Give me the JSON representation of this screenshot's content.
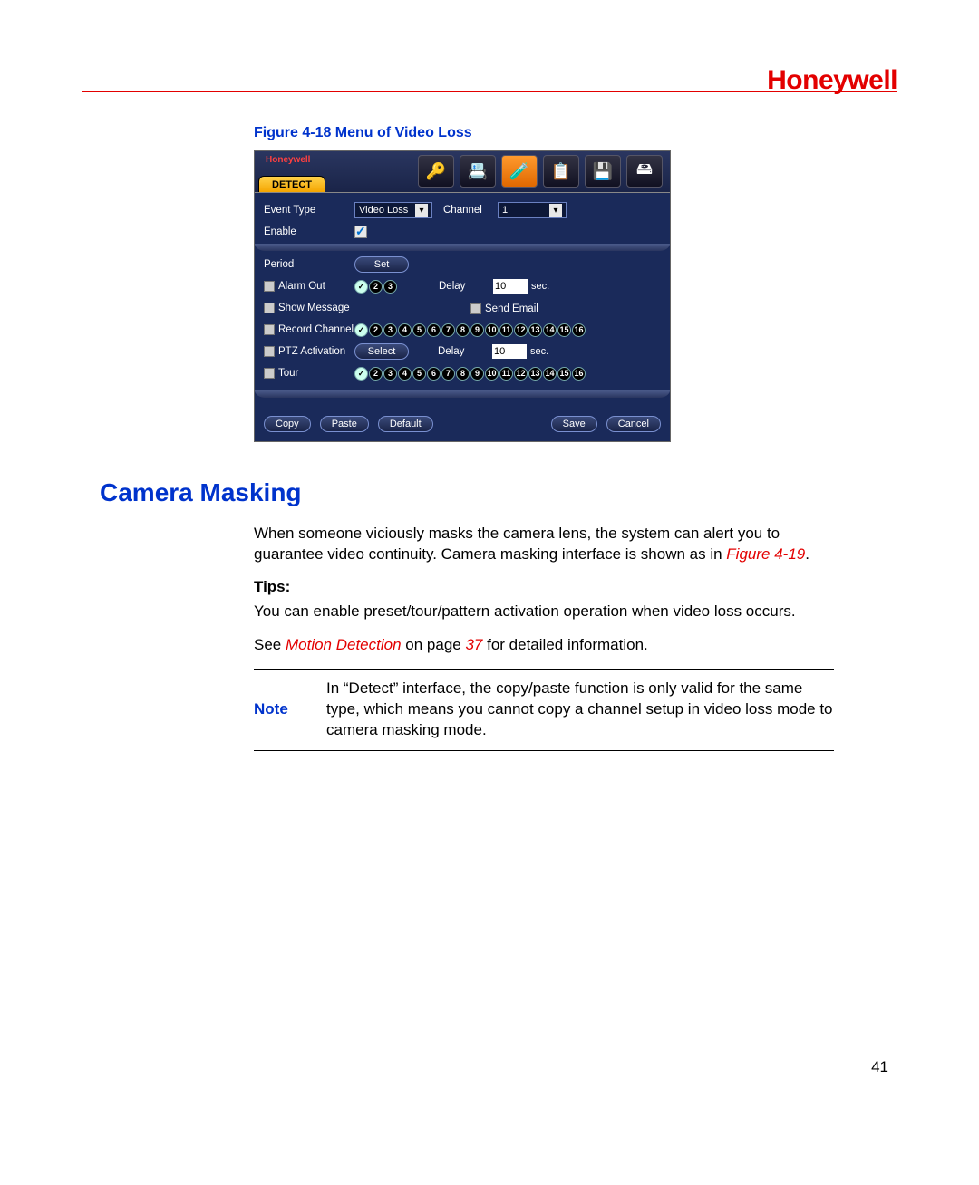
{
  "brand": "Honeywell",
  "figure_caption": "Figure 4-18 Menu of Video Loss",
  "dvr": {
    "logo": "Honeywell",
    "tab": "DETECT",
    "top_icons": [
      "keys-icon",
      "card-icon",
      "bottles-icon",
      "clipboard-icon",
      "disk-icon",
      "drive-icon"
    ],
    "highlight_icon_index": 2,
    "event_type_label": "Event Type",
    "event_type_value": "Video Loss",
    "channel_label": "Channel",
    "channel_value": "1",
    "enable_label": "Enable",
    "enable_checked": true,
    "period_label": "Period",
    "period_button": "Set",
    "alarm_out_label": "Alarm Out",
    "alarm_out_channels": [
      {
        "n": "1",
        "on": true
      },
      {
        "n": "2",
        "on": false
      },
      {
        "n": "3",
        "on": false
      }
    ],
    "delay_label": "Delay",
    "delay1_value": "10",
    "sec_label": "sec.",
    "show_message_label": "Show Message",
    "send_email_label": "Send Email",
    "record_channel_label": "Record Channel",
    "record_channels": [
      {
        "n": "1",
        "on": true
      },
      {
        "n": "2",
        "on": false
      },
      {
        "n": "3",
        "on": false
      },
      {
        "n": "4",
        "on": false
      },
      {
        "n": "5",
        "on": false
      },
      {
        "n": "6",
        "on": false
      },
      {
        "n": "7",
        "on": false
      },
      {
        "n": "8",
        "on": false
      },
      {
        "n": "9",
        "on": false
      },
      {
        "n": "10",
        "on": false
      },
      {
        "n": "11",
        "on": false
      },
      {
        "n": "12",
        "on": false
      },
      {
        "n": "13",
        "on": false
      },
      {
        "n": "14",
        "on": false
      },
      {
        "n": "15",
        "on": false
      },
      {
        "n": "16",
        "on": false
      }
    ],
    "ptz_label": "PTZ Activation",
    "ptz_button": "Select",
    "delay2_value": "10",
    "tour_label": "Tour",
    "tour_channels": [
      {
        "n": "1",
        "on": true
      },
      {
        "n": "2",
        "on": false
      },
      {
        "n": "3",
        "on": false
      },
      {
        "n": "4",
        "on": false
      },
      {
        "n": "5",
        "on": false
      },
      {
        "n": "6",
        "on": false
      },
      {
        "n": "7",
        "on": false
      },
      {
        "n": "8",
        "on": false
      },
      {
        "n": "9",
        "on": false
      },
      {
        "n": "10",
        "on": false
      },
      {
        "n": "11",
        "on": false
      },
      {
        "n": "12",
        "on": false
      },
      {
        "n": "13",
        "on": false
      },
      {
        "n": "14",
        "on": false
      },
      {
        "n": "15",
        "on": false
      },
      {
        "n": "16",
        "on": false
      }
    ],
    "footer": {
      "copy": "Copy",
      "paste": "Paste",
      "default": "Default",
      "save": "Save",
      "cancel": "Cancel"
    }
  },
  "section_title": "Camera Masking",
  "para1_a": "When someone viciously masks the camera lens, the system can alert you to guarantee video continuity. Camera masking interface is shown as in ",
  "para1_ref": "Figure 4-19",
  "para1_b": ".",
  "tips_label": "Tips:",
  "para2": "You can enable preset/tour/pattern activation operation when video loss occurs.",
  "para3_a": "See ",
  "para3_ref": "Motion Detection",
  "para3_b": " on page ",
  "para3_page": "37",
  "para3_c": " for detailed information.",
  "note_label": "Note",
  "note_text": "In “Detect” interface, the copy/paste function is only valid for the same type, which means you cannot copy a channel setup in video loss mode to camera masking mode.",
  "page_number": "41"
}
